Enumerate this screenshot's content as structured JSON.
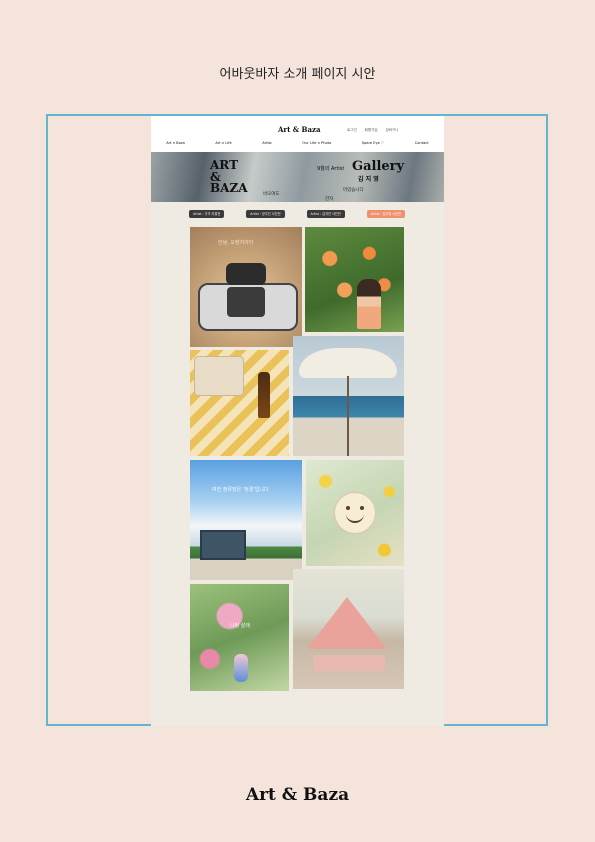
{
  "document": {
    "title": "어바웃바자 소개 페이지 시안",
    "footer_brand": "Art & Baza"
  },
  "site": {
    "brand": "Art & Baza",
    "top_links": [
      "로그인",
      "회원가입",
      "장바구니"
    ],
    "nav": [
      "Art n Baza",
      "Art n Life",
      "Artist",
      "Our Life n Photo",
      "Spare Eye ♡",
      "Contact"
    ],
    "hero": {
      "logo_lines": [
        "ART",
        "&",
        "BAZA"
      ],
      "sub_left": "바오여도",
      "sub_mid": "한자",
      "sub_right": "마었습니다",
      "month_label": "9월의 Artist",
      "gallery_label": "Gallery",
      "artist_name": "김 지 영"
    },
    "tabs": [
      {
        "label": "Artist : 가가 리뷰전",
        "active": false
      },
      {
        "label": "Artist : 방주진 사진전",
        "active": false
      },
      {
        "label": "Artist : 김지연 사진전",
        "active": false
      },
      {
        "label": "Artist : 김지영 사진전",
        "active": true
      }
    ],
    "photos": {
      "camera_caption": "안녕, 오렌지야아",
      "bus_caption": "여전 정류장은 '정경'입니다",
      "flower_caption": "나랑 살래"
    }
  },
  "colors": {
    "page_bg": "#f5e4dc",
    "frame_border": "#62b6d2",
    "site_bg": "#efebe3",
    "tab_bg": "#3a3a3a",
    "tab_active_bg": "#f0906c"
  }
}
